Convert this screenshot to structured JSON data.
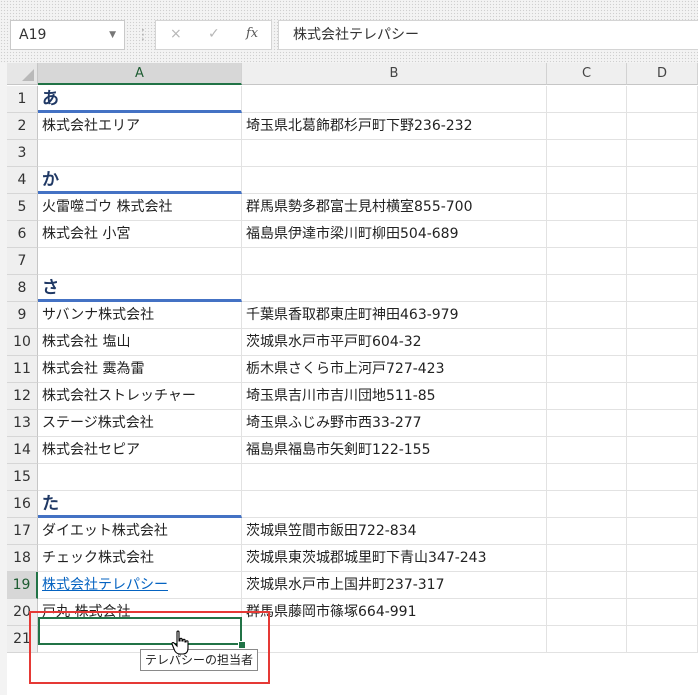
{
  "formula_bar": {
    "name_box": "A19",
    "formula": "株式会社テレパシー",
    "fx_label": "fx",
    "cancel_icon": "×",
    "enter_icon": "✓"
  },
  "columns": [
    "A",
    "B",
    "C",
    "D"
  ],
  "rows": [
    {
      "n": "1",
      "a": "あ",
      "b": ""
    },
    {
      "n": "2",
      "a": "株式会社エリア",
      "b": "埼玉県北葛飾郡杉戸町下野236-232"
    },
    {
      "n": "3",
      "a": "",
      "b": ""
    },
    {
      "n": "4",
      "a": "か",
      "b": ""
    },
    {
      "n": "5",
      "a": "火雷噬ゴウ 株式会社",
      "b": "群馬県勢多郡富士見村横室855-700"
    },
    {
      "n": "6",
      "a": "株式会社 小宮",
      "b": "福島県伊達市梁川町柳田504-689"
    },
    {
      "n": "7",
      "a": "",
      "b": ""
    },
    {
      "n": "8",
      "a": "さ",
      "b": ""
    },
    {
      "n": "9",
      "a": "サバンナ株式会社",
      "b": "千葉県香取郡東庄町神田463-979"
    },
    {
      "n": "10",
      "a": "株式会社 塩山",
      "b": "茨城県水戸市平戸町604-32"
    },
    {
      "n": "11",
      "a": "株式会社 霙為雷",
      "b": "栃木県さくら市上河戸727-423"
    },
    {
      "n": "12",
      "a": "株式会社ストレッチャー",
      "b": "埼玉県吉川市吉川団地511-85"
    },
    {
      "n": "13",
      "a": "ステージ株式会社",
      "b": "埼玉県ふじみ野市西33-277"
    },
    {
      "n": "14",
      "a": "株式会社セピア",
      "b": "福島県福島市矢剣町122-155"
    },
    {
      "n": "15",
      "a": "",
      "b": ""
    },
    {
      "n": "16",
      "a": "た",
      "b": ""
    },
    {
      "n": "17",
      "a": "ダイエット株式会社",
      "b": "茨城県笠間市飯田722-834"
    },
    {
      "n": "18",
      "a": "チェック株式会社",
      "b": "茨城県東茨城郡城里町下青山347-243"
    },
    {
      "n": "19",
      "a": "株式会社テレパシー",
      "b": "茨城県水戸市上国井町237-317"
    },
    {
      "n": "20",
      "a": "戸丸 株式会社",
      "b": "群馬県藤岡市篠塚664-991"
    },
    {
      "n": "21",
      "a": "",
      "b": ""
    }
  ],
  "tooltip": "テレパシーの担当者",
  "colors": {
    "accent": "#217346",
    "heading_underline": "#4472c4",
    "link": "#0563c1",
    "highlight": "#e53935"
  }
}
